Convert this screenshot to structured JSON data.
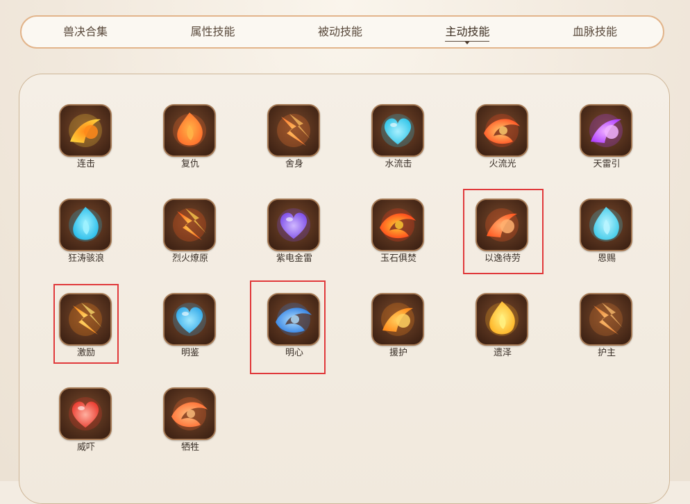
{
  "tabs": [
    {
      "label": "兽决合集",
      "active": false
    },
    {
      "label": "属性技能",
      "active": false
    },
    {
      "label": "被动技能",
      "active": false
    },
    {
      "label": "主动技能",
      "active": true
    },
    {
      "label": "血脉技能",
      "active": false
    }
  ],
  "skills": [
    {
      "name": "连击",
      "icon": "strike-chain-icon",
      "colors": [
        "#ffd13a",
        "#ff8a1a"
      ]
    },
    {
      "name": "复仇",
      "icon": "revenge-flame-icon",
      "colors": [
        "#ff6a2a",
        "#ffb347"
      ]
    },
    {
      "name": "舍身",
      "icon": "sacrifice-shield-icon",
      "colors": [
        "#ff7a30",
        "#ffc060"
      ]
    },
    {
      "name": "水流击",
      "icon": "water-claw-icon",
      "colors": [
        "#2ec4e8",
        "#a9f0ff"
      ]
    },
    {
      "name": "火流光",
      "icon": "fire-claw-icon",
      "colors": [
        "#ff4a1e",
        "#ffd070"
      ]
    },
    {
      "name": "天雷引",
      "icon": "thunder-claw-icon",
      "colors": [
        "#b040ff",
        "#f0b0ff"
      ]
    },
    {
      "name": "狂涛骇浪",
      "icon": "tidal-wave-icon",
      "colors": [
        "#20b8e8",
        "#9ff2ff"
      ]
    },
    {
      "name": "烈火燎原",
      "icon": "blaze-icon",
      "colors": [
        "#ff5a1a",
        "#ffd050"
      ]
    },
    {
      "name": "紫电金雷",
      "icon": "purple-lightning-icon",
      "colors": [
        "#7a4ae8",
        "#d0b8ff"
      ]
    },
    {
      "name": "玉石俱焚",
      "icon": "burning-stone-icon",
      "colors": [
        "#ff3a1a",
        "#ffcc33"
      ]
    },
    {
      "name": "以逸待劳",
      "icon": "rest-shield-icon",
      "colors": [
        "#ff5a22",
        "#ffb070"
      ]
    },
    {
      "name": "恩赐",
      "icon": "blessing-heart-icon",
      "colors": [
        "#3ac8e8",
        "#b8f4ff"
      ]
    },
    {
      "name": "激励",
      "icon": "inspire-swirl-icon",
      "colors": [
        "#ff8a1a",
        "#ffe070"
      ]
    },
    {
      "name": "明鉴",
      "icon": "insight-wave-icon",
      "colors": [
        "#30a8e8",
        "#a0e8ff"
      ]
    },
    {
      "name": "明心",
      "icon": "clear-heart-icon",
      "colors": [
        "#2a7ae0",
        "#b0e0ff"
      ]
    },
    {
      "name": "援护",
      "icon": "guard-shield-icon",
      "colors": [
        "#ff8a1a",
        "#ffd060"
      ]
    },
    {
      "name": "遗泽",
      "icon": "legacy-beast-icon",
      "colors": [
        "#ffb020",
        "#fff080"
      ]
    },
    {
      "name": "护主",
      "icon": "protector-warrior-icon",
      "colors": [
        "#e07a30",
        "#ffc070"
      ]
    },
    {
      "name": "威吓",
      "icon": "intimidate-swirl-icon",
      "colors": [
        "#e8362a",
        "#ffb0a0"
      ]
    },
    {
      "name": "牺牲",
      "icon": "sacrifice-heart-icon",
      "colors": [
        "#ff6a30",
        "#ffc080"
      ]
    }
  ],
  "highlighted": [
    "以逸待劳",
    "激励",
    "明心"
  ],
  "colors": {
    "tab_border": "#e2b48a",
    "panel_border": "#cdb596",
    "icon_frame": "#5a3420",
    "highlight": "#e0383a"
  }
}
